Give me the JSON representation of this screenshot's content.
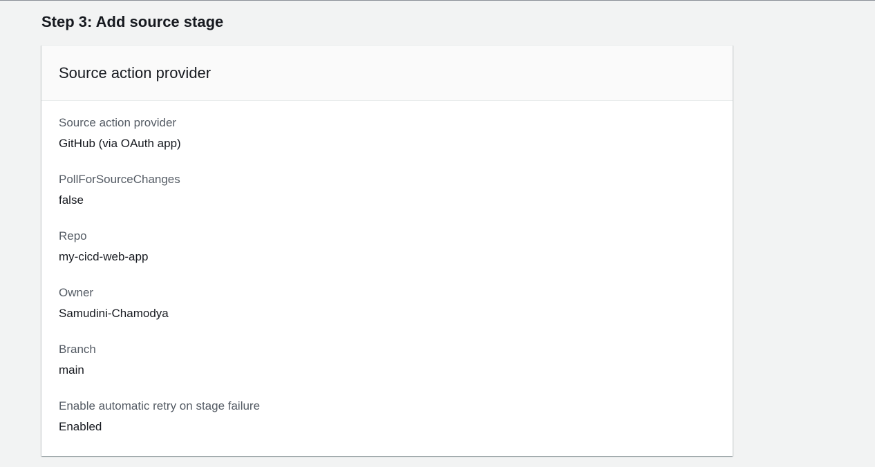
{
  "page": {
    "step_title": "Step 3: Add source stage"
  },
  "panel": {
    "title": "Source action provider",
    "fields": [
      {
        "label": "Source action provider",
        "value": "GitHub (via OAuth app)"
      },
      {
        "label": "PollForSourceChanges",
        "value": "false"
      },
      {
        "label": "Repo",
        "value": "my-cicd-web-app"
      },
      {
        "label": "Owner",
        "value": "Samudini-Chamodya"
      },
      {
        "label": "Branch",
        "value": "main"
      },
      {
        "label": "Enable automatic retry on stage failure",
        "value": "Enabled"
      }
    ]
  }
}
